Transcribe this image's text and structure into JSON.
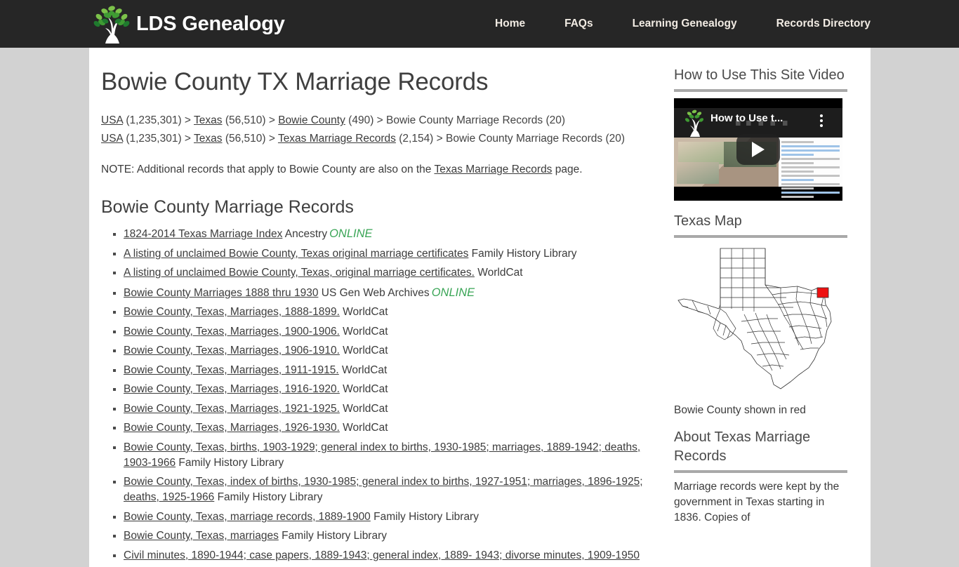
{
  "header": {
    "logo_text": "LDS Genealogy",
    "logo_icon": "family-tree-icon",
    "nav": [
      {
        "label": "Home"
      },
      {
        "label": "FAQs"
      },
      {
        "label": "Learning Genealogy"
      },
      {
        "label": "Records Directory"
      }
    ]
  },
  "main": {
    "title": "Bowie County TX Marriage Records",
    "breadcrumbs": [
      {
        "items": [
          {
            "label": "USA",
            "link": true,
            "count": "(1,235,301)"
          },
          {
            "label": "Texas",
            "link": true,
            "count": "(56,510)"
          },
          {
            "label": "Bowie County",
            "link": true,
            "count": "(490)"
          },
          {
            "label": "Bowie County Marriage Records",
            "link": false,
            "count": "(20)"
          }
        ]
      },
      {
        "items": [
          {
            "label": "USA",
            "link": true,
            "count": "(1,235,301)"
          },
          {
            "label": "Texas",
            "link": true,
            "count": "(56,510)"
          },
          {
            "label": "Texas Marriage Records",
            "link": true,
            "count": "(2,154)"
          },
          {
            "label": "Bowie County Marriage Records",
            "link": false,
            "count": "(20)"
          }
        ]
      }
    ],
    "note_prefix": "NOTE: Additional records that apply to Bowie County are also on the ",
    "note_link": "Texas Marriage Records",
    "note_suffix": " page.",
    "section_title": "Bowie County Marriage Records",
    "records": [
      {
        "title": "1824-2014 Texas Marriage Index",
        "source": "Ancestry",
        "badge": "ONLINE"
      },
      {
        "title": "A listing of unclaimed Bowie County, Texas original marriage certificates",
        "source": "Family History Library",
        "badge": ""
      },
      {
        "title": "A listing of unclaimed Bowie County, Texas, original marriage certificates.",
        "source": "WorldCat",
        "badge": ""
      },
      {
        "title": "Bowie County Marriages 1888 thru 1930",
        "source": "US Gen Web Archives",
        "badge": "ONLINE"
      },
      {
        "title": "Bowie County, Texas, Marriages, 1888-1899.",
        "source": "WorldCat",
        "badge": ""
      },
      {
        "title": "Bowie County, Texas, Marriages, 1900-1906.",
        "source": "WorldCat",
        "badge": ""
      },
      {
        "title": "Bowie County, Texas, Marriages, 1906-1910.",
        "source": "WorldCat",
        "badge": ""
      },
      {
        "title": "Bowie County, Texas, Marriages, 1911-1915.",
        "source": "WorldCat",
        "badge": ""
      },
      {
        "title": "Bowie County, Texas, Marriages, 1916-1920.",
        "source": "WorldCat",
        "badge": ""
      },
      {
        "title": "Bowie County, Texas, Marriages, 1921-1925.",
        "source": "WorldCat",
        "badge": ""
      },
      {
        "title": "Bowie County, Texas, Marriages, 1926-1930.",
        "source": "WorldCat",
        "badge": ""
      },
      {
        "title": "Bowie County, Texas, births, 1903-1929; general index to births, 1930-1985; marriages, 1889-1942; deaths, 1903-1966",
        "source": "Family History Library",
        "badge": ""
      },
      {
        "title": "Bowie County, Texas, index of births, 1930-1985; general index to births, 1927-1951; marriages, 1896-1925; deaths, 1925-1966",
        "source": "Family History Library",
        "badge": ""
      },
      {
        "title": "Bowie County, Texas, marriage records, 1889-1900",
        "source": "Family History Library",
        "badge": ""
      },
      {
        "title": "Bowie County, Texas, marriages",
        "source": "Family History Library",
        "badge": ""
      },
      {
        "title": "Civil minutes, 1890-1944; case papers, 1889-1943; general index, 1889- 1943; divorse minutes, 1909-1950",
        "source": "",
        "badge": ""
      }
    ]
  },
  "sidebar": {
    "video_widget": {
      "title": "How to Use This Site Video",
      "video_title": "How to Use t...",
      "play_icon": "play-button-icon",
      "menu_icon": "kebab-menu-icon"
    },
    "map_widget": {
      "title": "Texas Map",
      "caption": "Bowie County shown in red",
      "highlight_color": "#ee1111"
    },
    "about_widget": {
      "title": "About Texas Marriage Records",
      "text": "Marriage records were kept by the government in Texas starting in 1836. Copies of"
    }
  },
  "colors": {
    "header_bg": "#262626",
    "page_bg": "#d2d2d2",
    "content_bg": "#ffffff",
    "text": "#3c3c3c",
    "online_green": "#3aa556",
    "rule_gray": "#a9a9a9"
  }
}
